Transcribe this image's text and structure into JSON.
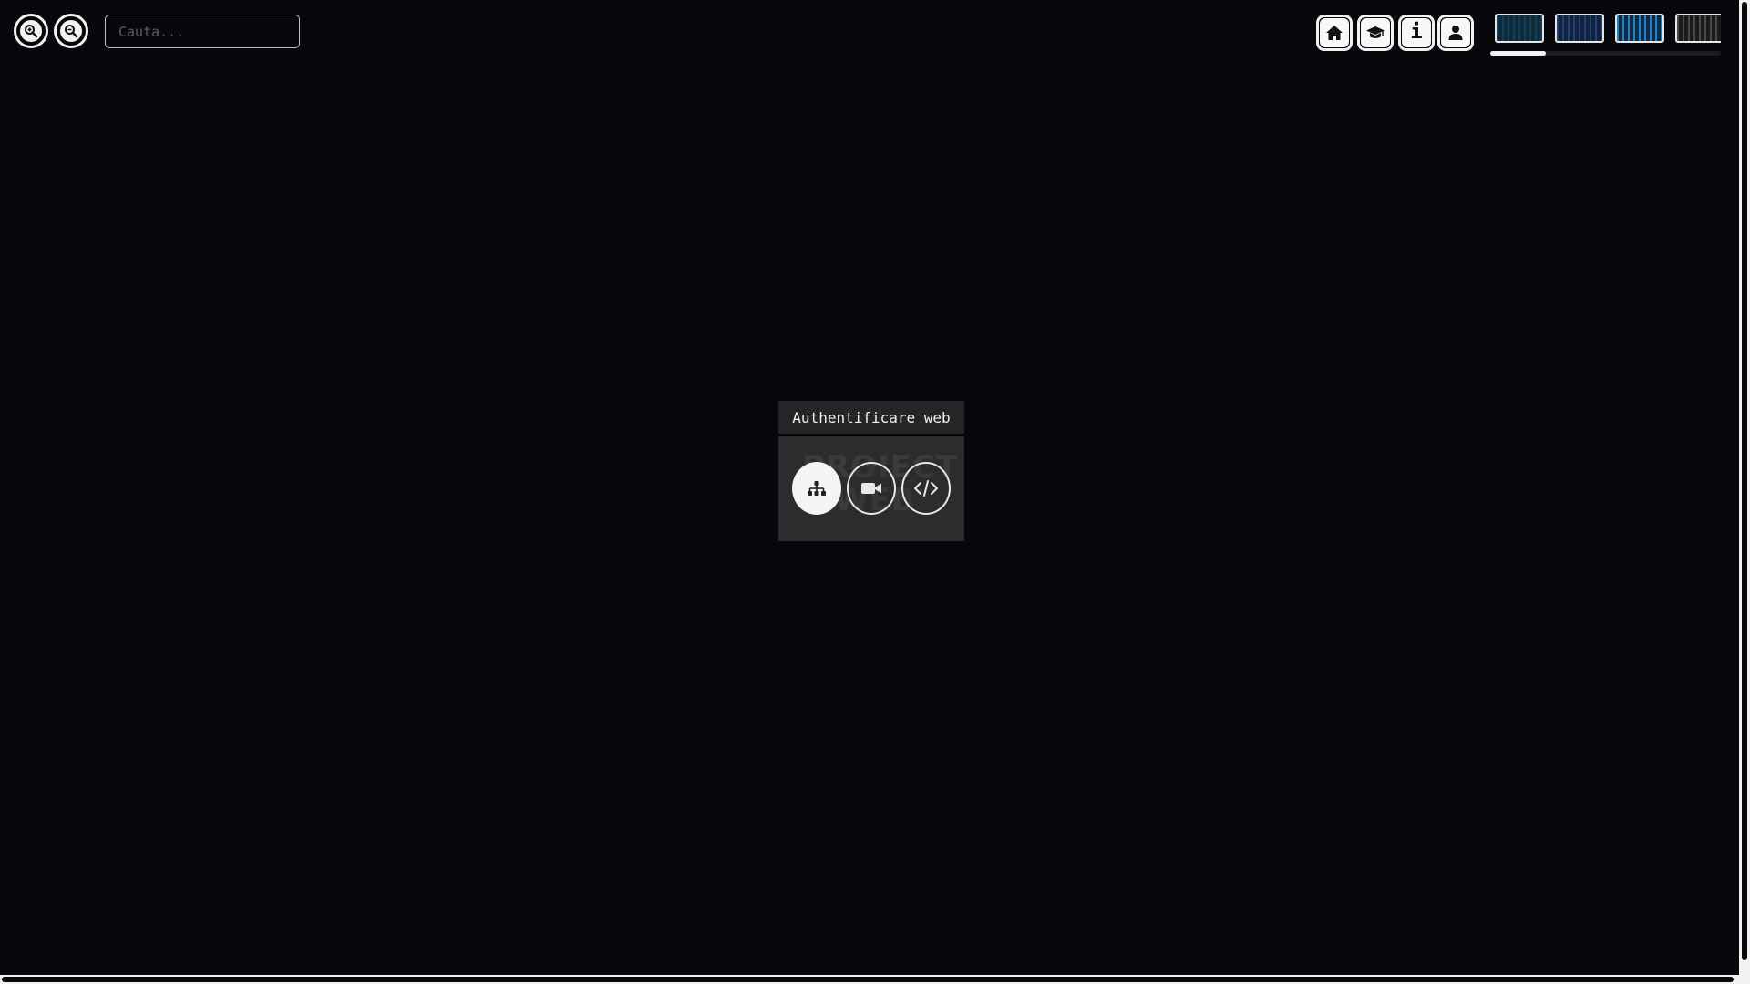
{
  "toolbar": {
    "zoom_in_icon": "zoom-in-icon",
    "zoom_out_icon": "zoom-out-icon",
    "search": {
      "placeholder": "Cauta...",
      "value": ""
    }
  },
  "nav": {
    "items": [
      {
        "name": "home",
        "icon": "home-icon"
      },
      {
        "name": "courses",
        "icon": "graduation-cap-icon"
      },
      {
        "name": "info",
        "icon": "info-icon",
        "glyph": "i"
      },
      {
        "name": "account",
        "icon": "user-icon"
      }
    ],
    "themes_carousel": {
      "thumbnails": [
        {
          "name": "theme-1",
          "colors": [
            "#0d2b3d",
            "#123f55",
            "#0a1d2a"
          ]
        },
        {
          "name": "theme-2",
          "colors": [
            "#0f2240",
            "#24406e",
            "#0b1830"
          ]
        },
        {
          "name": "theme-3",
          "colors": [
            "#0a2c4a",
            "#2a7fb8",
            "#0c2036"
          ]
        },
        {
          "name": "theme-4",
          "colors": [
            "#1b1b1b",
            "#4a4a4a",
            "#101010"
          ]
        }
      ],
      "scroll_fraction": 0.24
    }
  },
  "node": {
    "label": "Authentificare web",
    "background_text": "PROIECT\nWEB",
    "actions": [
      {
        "name": "structure",
        "icon": "sitemap-icon"
      },
      {
        "name": "video",
        "icon": "video-camera-icon"
      },
      {
        "name": "code",
        "icon": "code-icon"
      }
    ]
  },
  "colors": {
    "background": "#07070c",
    "foreground": "#f2f2f2",
    "node_label_bg": "#252527",
    "node_card_bg": "#2c2c2e"
  }
}
